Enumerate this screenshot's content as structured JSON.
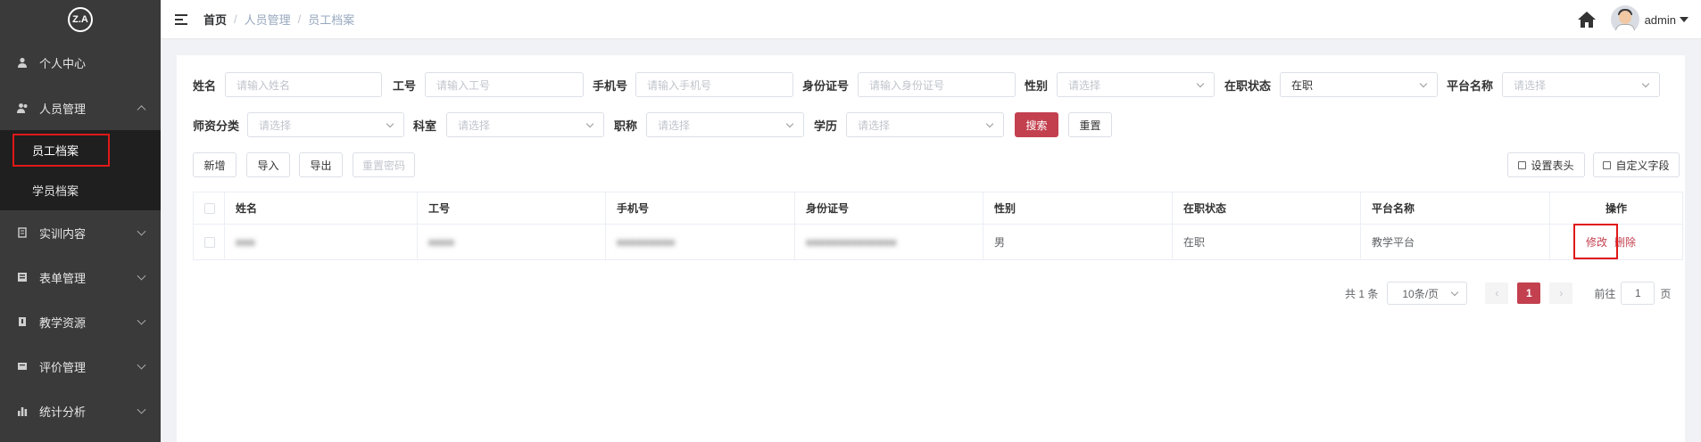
{
  "logo": {
    "text": "Z.A"
  },
  "sidebar": {
    "items": [
      {
        "label": "个人中心",
        "icon": "user-icon"
      },
      {
        "label": "人员管理",
        "icon": "users-icon",
        "expanded": true,
        "children": [
          {
            "label": "员工档案",
            "active": true
          },
          {
            "label": "学员档案"
          }
        ]
      },
      {
        "label": "实训内容",
        "icon": "book-icon"
      },
      {
        "label": "表单管理",
        "icon": "form-icon"
      },
      {
        "label": "教学资源",
        "icon": "resource-icon"
      },
      {
        "label": "评价管理",
        "icon": "rating-icon"
      },
      {
        "label": "统计分析",
        "icon": "chart-icon"
      }
    ]
  },
  "header": {
    "breadcrumb": [
      "首页",
      "人员管理",
      "员工档案"
    ],
    "username": "admin"
  },
  "filters": {
    "name": {
      "label": "姓名",
      "placeholder": "请输入姓名"
    },
    "job_no": {
      "label": "工号",
      "placeholder": "请输入工号"
    },
    "phone": {
      "label": "手机号",
      "placeholder": "请输入手机号"
    },
    "id_no": {
      "label": "身份证号",
      "placeholder": "请输入身份证号"
    },
    "gender": {
      "label": "性别",
      "placeholder": "请选择"
    },
    "status": {
      "label": "在职状态",
      "value": "在职"
    },
    "platform": {
      "label": "平台名称",
      "placeholder": "请选择"
    },
    "teacher_type": {
      "label": "师资分类",
      "placeholder": "请选择"
    },
    "department": {
      "label": "科室",
      "placeholder": "请选择"
    },
    "title": {
      "label": "职称",
      "placeholder": "请选择"
    },
    "education": {
      "label": "学历",
      "placeholder": "请选择"
    },
    "search_btn": "搜索",
    "reset_btn": "重置"
  },
  "toolbar": {
    "add": "新增",
    "import": "导入",
    "export": "导出",
    "reset_password": "重置密码",
    "set_header": "设置表头",
    "custom_fields": "自定义字段"
  },
  "table": {
    "columns": [
      "姓名",
      "工号",
      "手机号",
      "身份证号",
      "性别",
      "在职状态",
      "平台名称",
      "操作"
    ],
    "rows": [
      {
        "name": "■■■",
        "job_no": "■■■■",
        "phone": "■■■■■■■■■",
        "id_no": "■■■■■■■■■■■■■■",
        "gender": "男",
        "status": "在职",
        "platform": "教学平台",
        "edit": "修改",
        "delete": "删除"
      }
    ]
  },
  "pagination": {
    "total": "共 1 条",
    "page_size": "10条/页",
    "current_page": "1",
    "goto_label": "前往",
    "goto_value": "1",
    "page_suffix": "页"
  },
  "colors": {
    "accent": "#c3404f",
    "sidebar": "#3a3a3a",
    "submenu": "#1f1f1f",
    "highlight": "#e01818"
  }
}
